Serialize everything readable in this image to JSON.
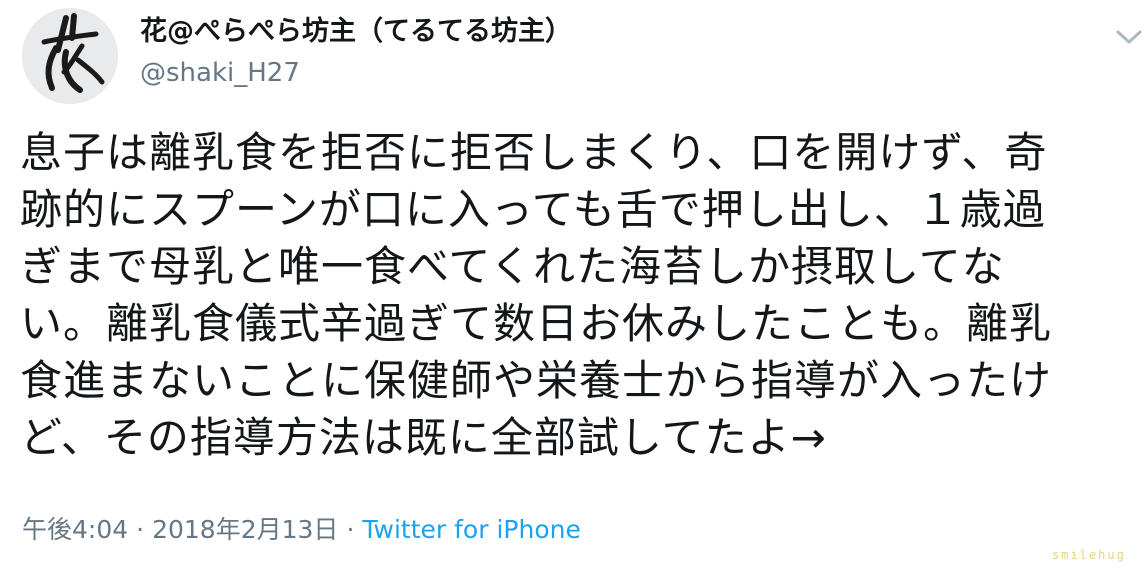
{
  "author": {
    "display_name": "花@ぺらぺら坊主（てるてる坊主）",
    "username": "@shaki_H27",
    "avatar_icon": "calligraphy-avatar-icon"
  },
  "tweet": {
    "text": "息子は離乳食を拒否に拒否しまくり、口を開けず、奇\n跡的にスプーンが口に入っても舌で押し出し、１歳過\nぎまで母乳と唯一食べてくれた海苔しか摂取してな\nい。離乳食儀式辛過ぎて数日お休みしたことも。離乳\n食進まないことに保健師や栄養士から指導が入ったけ\nど、その指導方法は既に全部試してたよ→"
  },
  "meta": {
    "time": "午後4:04",
    "separator": "·",
    "date": "2018年2月13日",
    "source": "Twitter for iPhone"
  },
  "watermark": "smilehug",
  "colors": {
    "text": "#14171a",
    "secondary": "#657786",
    "link": "#1da1f2",
    "watermark": "#e8d27a"
  }
}
